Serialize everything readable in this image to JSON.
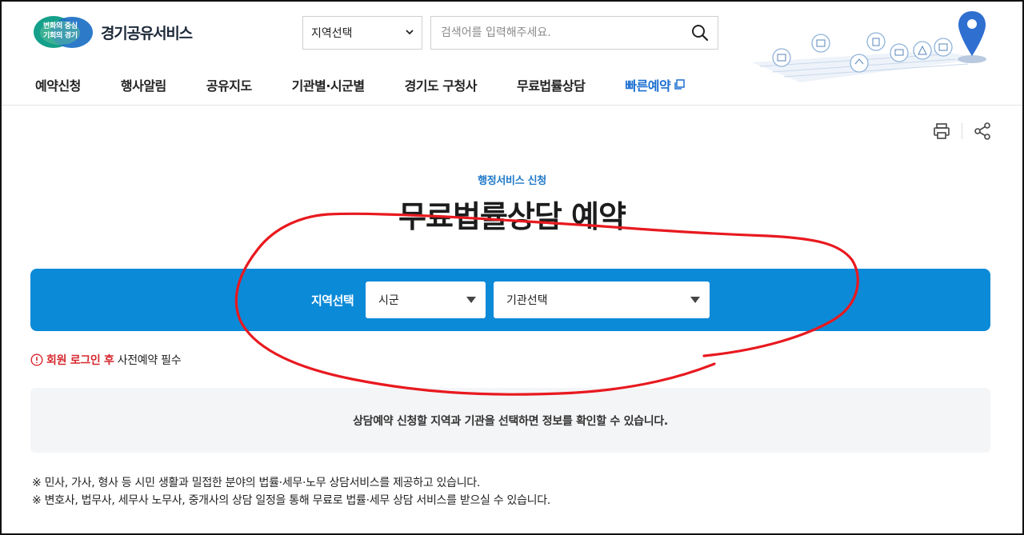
{
  "header": {
    "logo_line1": "변화의 중심",
    "logo_line2": "기회의 경기",
    "logo_text": "경기공유서비스",
    "region_select_value": "지역선택",
    "search_placeholder": "검색어를 입력해주세요."
  },
  "nav": {
    "items": [
      "예약신청",
      "행사알림",
      "공유지도",
      "기관별·시군별",
      "경기도 구청사",
      "무료법률상담"
    ],
    "fast_reservation": "빠른예약"
  },
  "page": {
    "subtitle": "행정서비스 신청",
    "title": "무료법률상담 예약"
  },
  "selector": {
    "label": "지역선택",
    "city_value": "시군",
    "org_value": "기관선택"
  },
  "notice": {
    "warn_text": "회원 로그인 후",
    "normal_text": "사전예약 필수"
  },
  "info": {
    "message": "상담예약 신청할 지역과 기관을 선택하면 정보를 확인할 수 있습니다."
  },
  "notes": {
    "line1": "※ 민사, 가사, 형사 등 시민 생활과 밀접한 분야의 법률·세무·노무 상담서비스를 제공하고 있습니다.",
    "line2": "※ 변호사, 법무사, 세무사 노무사, 중개사의 상담 일정을 통해 무료로 법률·세무 상담 서비스를 받으실 수 있습니다."
  },
  "colors": {
    "brand_blue": "#0b8ad8",
    "link_blue": "#1d6fd1",
    "warning_red": "#d6272e",
    "annotation_red": "#e8191f"
  }
}
